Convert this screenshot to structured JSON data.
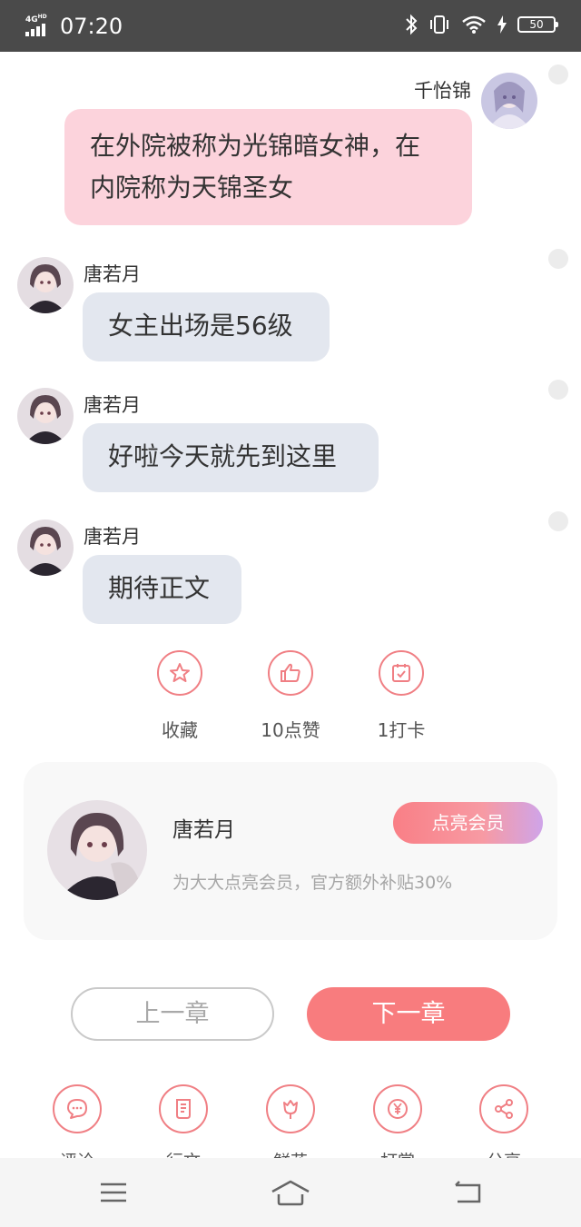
{
  "status_bar": {
    "network": "4G",
    "network_sup": "HD",
    "time": "07:20",
    "battery": "50"
  },
  "messages": [
    {
      "sender": "千怡锦",
      "text_lines": [
        "在外院被称为光锦暗女神，在",
        "内院称为天锦圣女"
      ],
      "side": "right"
    },
    {
      "sender": "唐若月",
      "text": "女主出场是56级",
      "side": "left"
    },
    {
      "sender": "唐若月",
      "text": "好啦今天就先到这里",
      "side": "left"
    },
    {
      "sender": "唐若月",
      "text": "期待正文",
      "side": "left"
    }
  ],
  "actions": {
    "favorite": "收藏",
    "like": "10点赞",
    "checkin": "1打卡"
  },
  "vip_card": {
    "author": "唐若月",
    "button": "点亮会员",
    "subtitle": "为大大点亮会员，官方额外补贴30%"
  },
  "chapter_nav": {
    "prev": "上一章",
    "next": "下一章"
  },
  "toolbar": {
    "comment": "评论",
    "long_review": "行文",
    "flower": "鲜花",
    "reward": "打赏",
    "share": "分享"
  },
  "colors": {
    "accent": "#f87c7e",
    "bubble_pink": "#fcd3dc",
    "bubble_gray": "#e3e7ef"
  }
}
